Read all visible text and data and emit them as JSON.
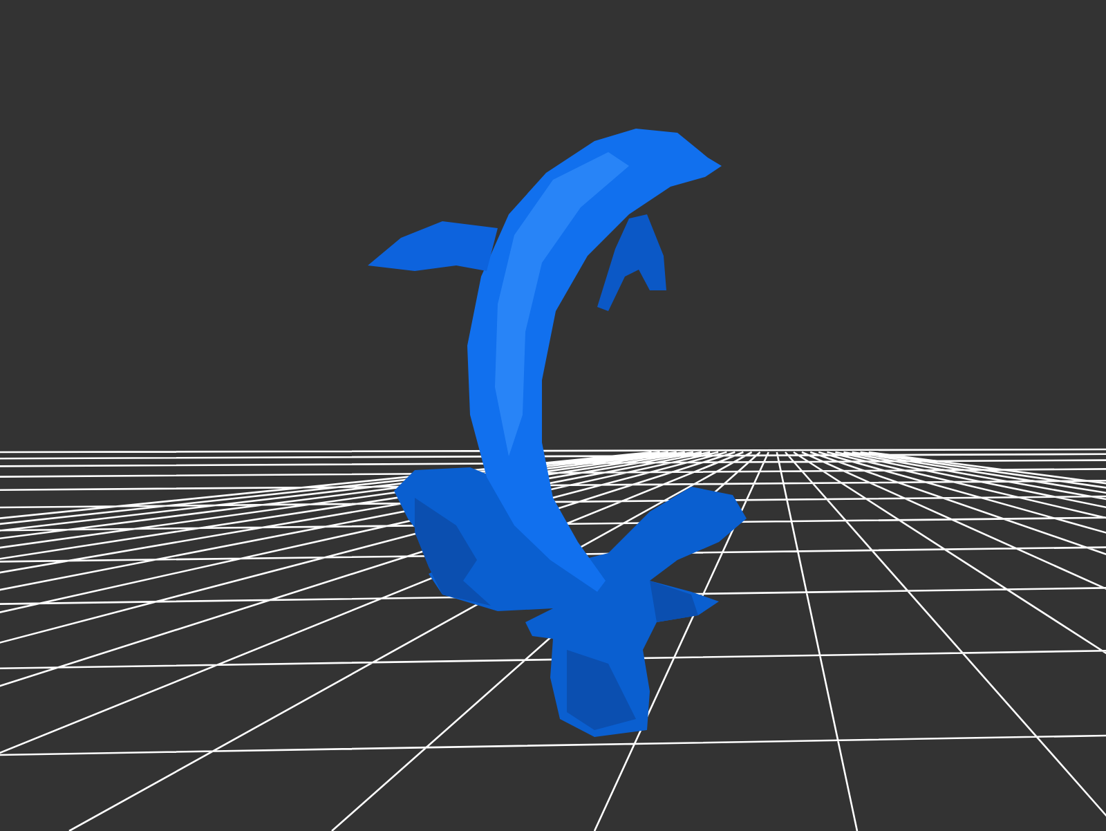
{
  "viewport": {
    "grid_visible": true
  }
}
